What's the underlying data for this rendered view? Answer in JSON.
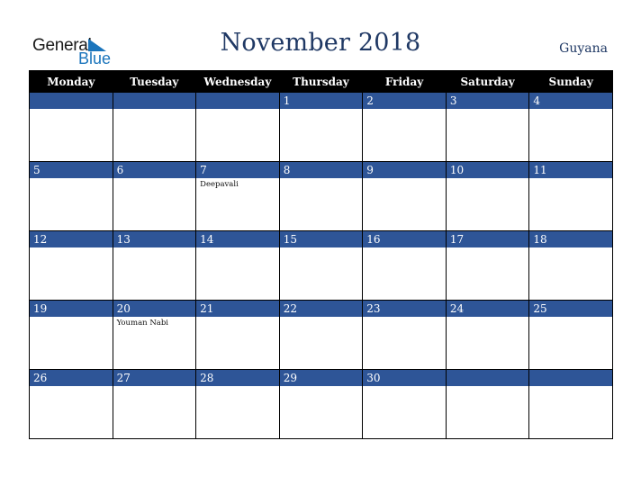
{
  "logo": {
    "word1": "General",
    "word2": "Blue",
    "brand_color": "#1b75bc"
  },
  "header": {
    "title": "November 2018",
    "country": "Guyana"
  },
  "colors": {
    "band": "#2e5597",
    "header_bg": "#000000",
    "title": "#1f3864"
  },
  "weekdays": [
    "Monday",
    "Tuesday",
    "Wednesday",
    "Thursday",
    "Friday",
    "Saturday",
    "Sunday"
  ],
  "weeks": [
    [
      {
        "day": "",
        "event": ""
      },
      {
        "day": "",
        "event": ""
      },
      {
        "day": "",
        "event": ""
      },
      {
        "day": "1",
        "event": ""
      },
      {
        "day": "2",
        "event": ""
      },
      {
        "day": "3",
        "event": ""
      },
      {
        "day": "4",
        "event": ""
      }
    ],
    [
      {
        "day": "5",
        "event": ""
      },
      {
        "day": "6",
        "event": ""
      },
      {
        "day": "7",
        "event": "Deepavali"
      },
      {
        "day": "8",
        "event": ""
      },
      {
        "day": "9",
        "event": ""
      },
      {
        "day": "10",
        "event": ""
      },
      {
        "day": "11",
        "event": ""
      }
    ],
    [
      {
        "day": "12",
        "event": ""
      },
      {
        "day": "13",
        "event": ""
      },
      {
        "day": "14",
        "event": ""
      },
      {
        "day": "15",
        "event": ""
      },
      {
        "day": "16",
        "event": ""
      },
      {
        "day": "17",
        "event": ""
      },
      {
        "day": "18",
        "event": ""
      }
    ],
    [
      {
        "day": "19",
        "event": ""
      },
      {
        "day": "20",
        "event": "Youman Nabi"
      },
      {
        "day": "21",
        "event": ""
      },
      {
        "day": "22",
        "event": ""
      },
      {
        "day": "23",
        "event": ""
      },
      {
        "day": "24",
        "event": ""
      },
      {
        "day": "25",
        "event": ""
      }
    ],
    [
      {
        "day": "26",
        "event": ""
      },
      {
        "day": "27",
        "event": ""
      },
      {
        "day": "28",
        "event": ""
      },
      {
        "day": "29",
        "event": ""
      },
      {
        "day": "30",
        "event": ""
      },
      {
        "day": "",
        "event": ""
      },
      {
        "day": "",
        "event": ""
      }
    ]
  ]
}
